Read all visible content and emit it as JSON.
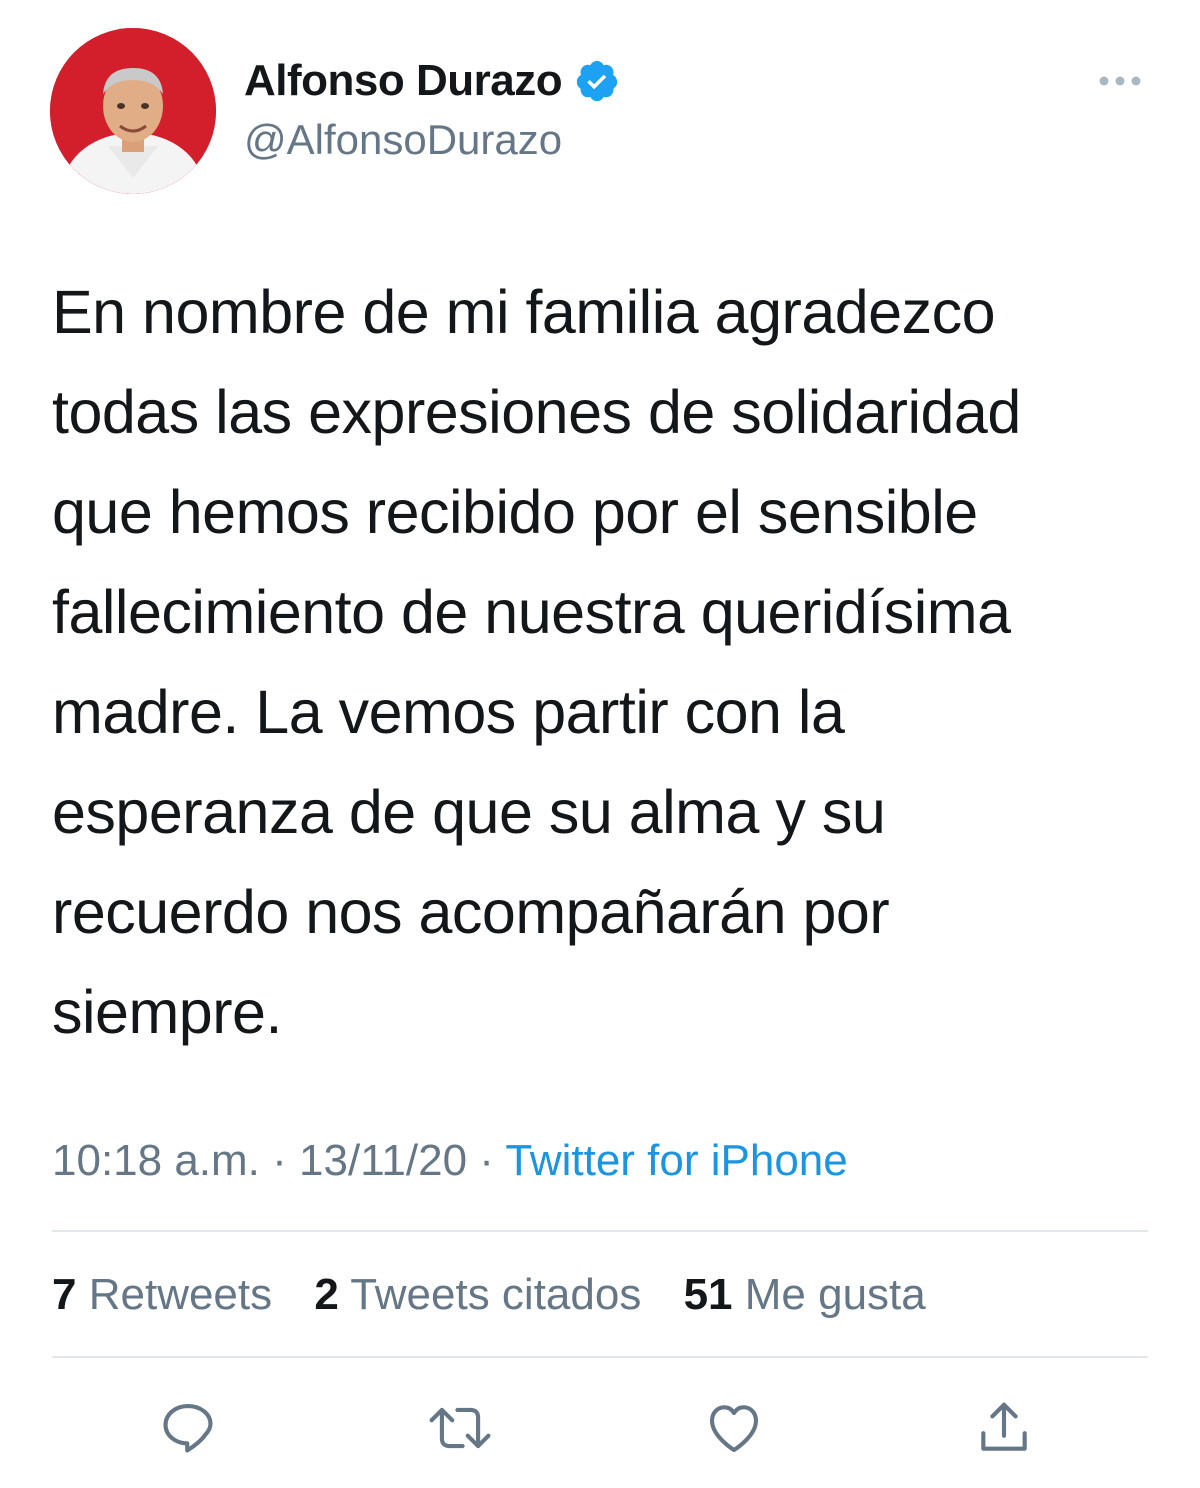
{
  "author": {
    "display_name": "Alfonso Durazo",
    "handle": "@AlfonsoDurazo",
    "verified": true,
    "avatar_icon": "profile-photo"
  },
  "tweet": {
    "text": "En nombre de mi familia agradezco\ntodas las expresiones de solidaridad\nque hemos recibido por el sensible\nfallecimiento de nuestra queridísima\nmadre. La vemos partir con la\nesperanza de que su alma y su\nrecuerdo nos  acompañarán por\nsiempre.",
    "time": "10:18 a.m.",
    "separator": "·",
    "date": "13/11/20",
    "source": "Twitter for iPhone"
  },
  "stats": {
    "retweets_count": "7",
    "retweets_label": "Retweets",
    "quotes_count": "2",
    "quotes_label": "Tweets citados",
    "likes_count": "51",
    "likes_label": "Me gusta"
  },
  "actions": [
    {
      "icon": "reply-icon"
    },
    {
      "icon": "retweet-icon"
    },
    {
      "icon": "like-icon"
    },
    {
      "icon": "share-icon"
    }
  ],
  "colors": {
    "text": "#14171a",
    "secondary": "#657786",
    "link": "#1b95e0",
    "verified": "#1da1f2",
    "avatar_bg": "#d21f2b",
    "divider": "#e1e8ed"
  }
}
